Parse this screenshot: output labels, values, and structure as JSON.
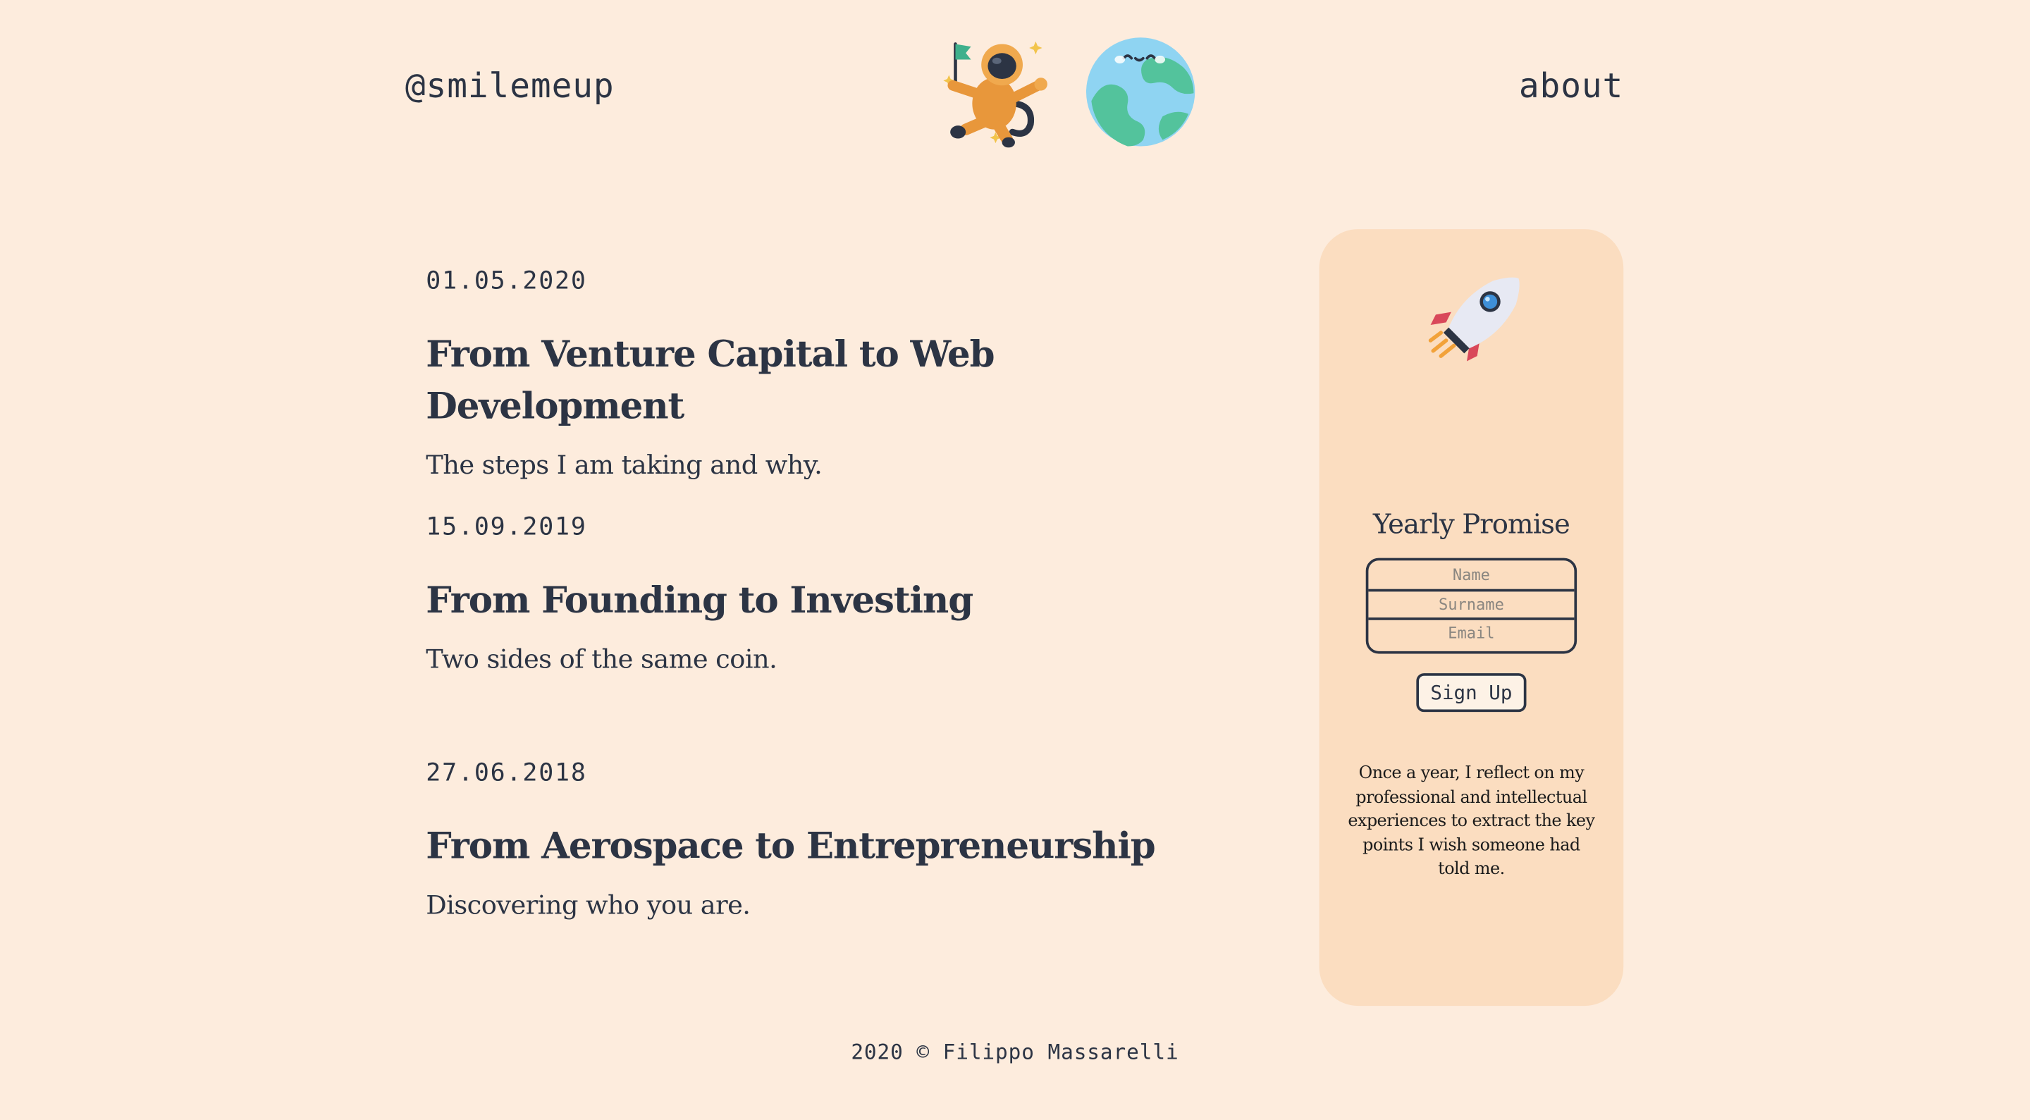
{
  "header": {
    "brand": "@smilemeup",
    "about_link": "about",
    "astronaut_icon": "astronaut-icon",
    "earth_icon": "earth-icon"
  },
  "posts": [
    {
      "date": "01.05.2020",
      "title": "From Venture Capital to Web Development",
      "subtitle": "The steps I am taking and why."
    },
    {
      "date": "15.09.2019",
      "title": "From Founding to Investing",
      "subtitle": "Two sides of the same coin."
    },
    {
      "date": "27.06.2018",
      "title": "From Aerospace to Entrepreneurship",
      "subtitle": "Discovering who you are."
    }
  ],
  "sidebar": {
    "rocket_icon": "rocket-icon",
    "title": "Yearly Promise",
    "name_placeholder": "Name",
    "surname_placeholder": "Surname",
    "email_placeholder": "Email",
    "signup_label": "Sign Up",
    "description": "Once a year, I reflect on my professional and intellectual experiences to extract the key points I wish someone had told me."
  },
  "footer": {
    "copyright": "2020 © Filippo Massarelli"
  },
  "colors": {
    "background": "#fdecdd",
    "card": "#fbddc0",
    "text": "#2c3444"
  }
}
